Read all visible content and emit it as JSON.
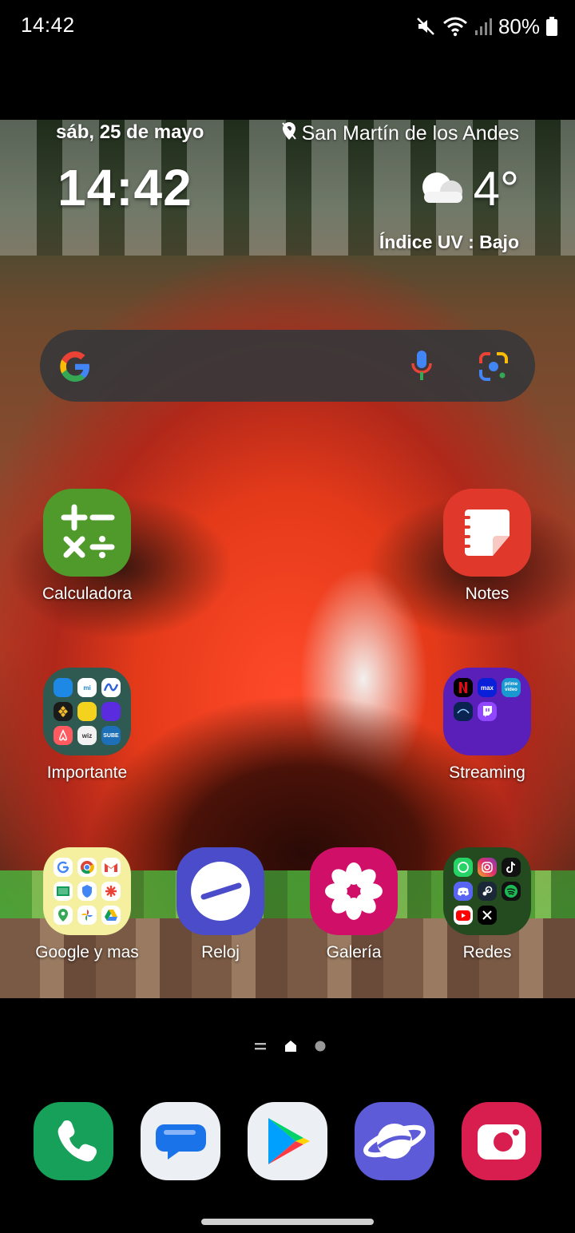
{
  "status_bar": {
    "time": "14:42",
    "battery_percent": "80%",
    "icons": [
      "mute-icon",
      "wifi-icon",
      "signal-icon",
      "battery-icon"
    ]
  },
  "widget": {
    "date": "sáb, 25 de mayo",
    "location": "San Martín de los Andes",
    "time": "14:42",
    "temperature": "4°",
    "uv_index": "Índice UV : Bajo",
    "weather_icon": "partly-cloudy-icon"
  },
  "search_bar": {
    "icons": [
      "google-g-icon",
      "microphone-icon",
      "google-lens-icon"
    ]
  },
  "apps": {
    "calculadora": "Calculadora",
    "notes": "Notes",
    "importante": "Importante",
    "streaming": "Streaming",
    "google": "Google y mas",
    "reloj": "Reloj",
    "galeria": "Galería",
    "redes": "Redes"
  },
  "folder_minis": {
    "importante": [
      "mi",
      "wiz",
      "SUBE"
    ],
    "streaming": [
      "max",
      "prime video"
    ]
  },
  "dock": [
    "phone-icon",
    "messages-icon",
    "play-store-icon",
    "internet-icon",
    "camera-icon"
  ],
  "colors": {
    "calculadora": "#4f9a2a",
    "notes": "#e0392b",
    "reloj": "#4b4cc9",
    "galeria": "#cf0f68",
    "phone": "#16a05a",
    "camera": "#d81e4f",
    "internet": "#5d5bd8"
  }
}
